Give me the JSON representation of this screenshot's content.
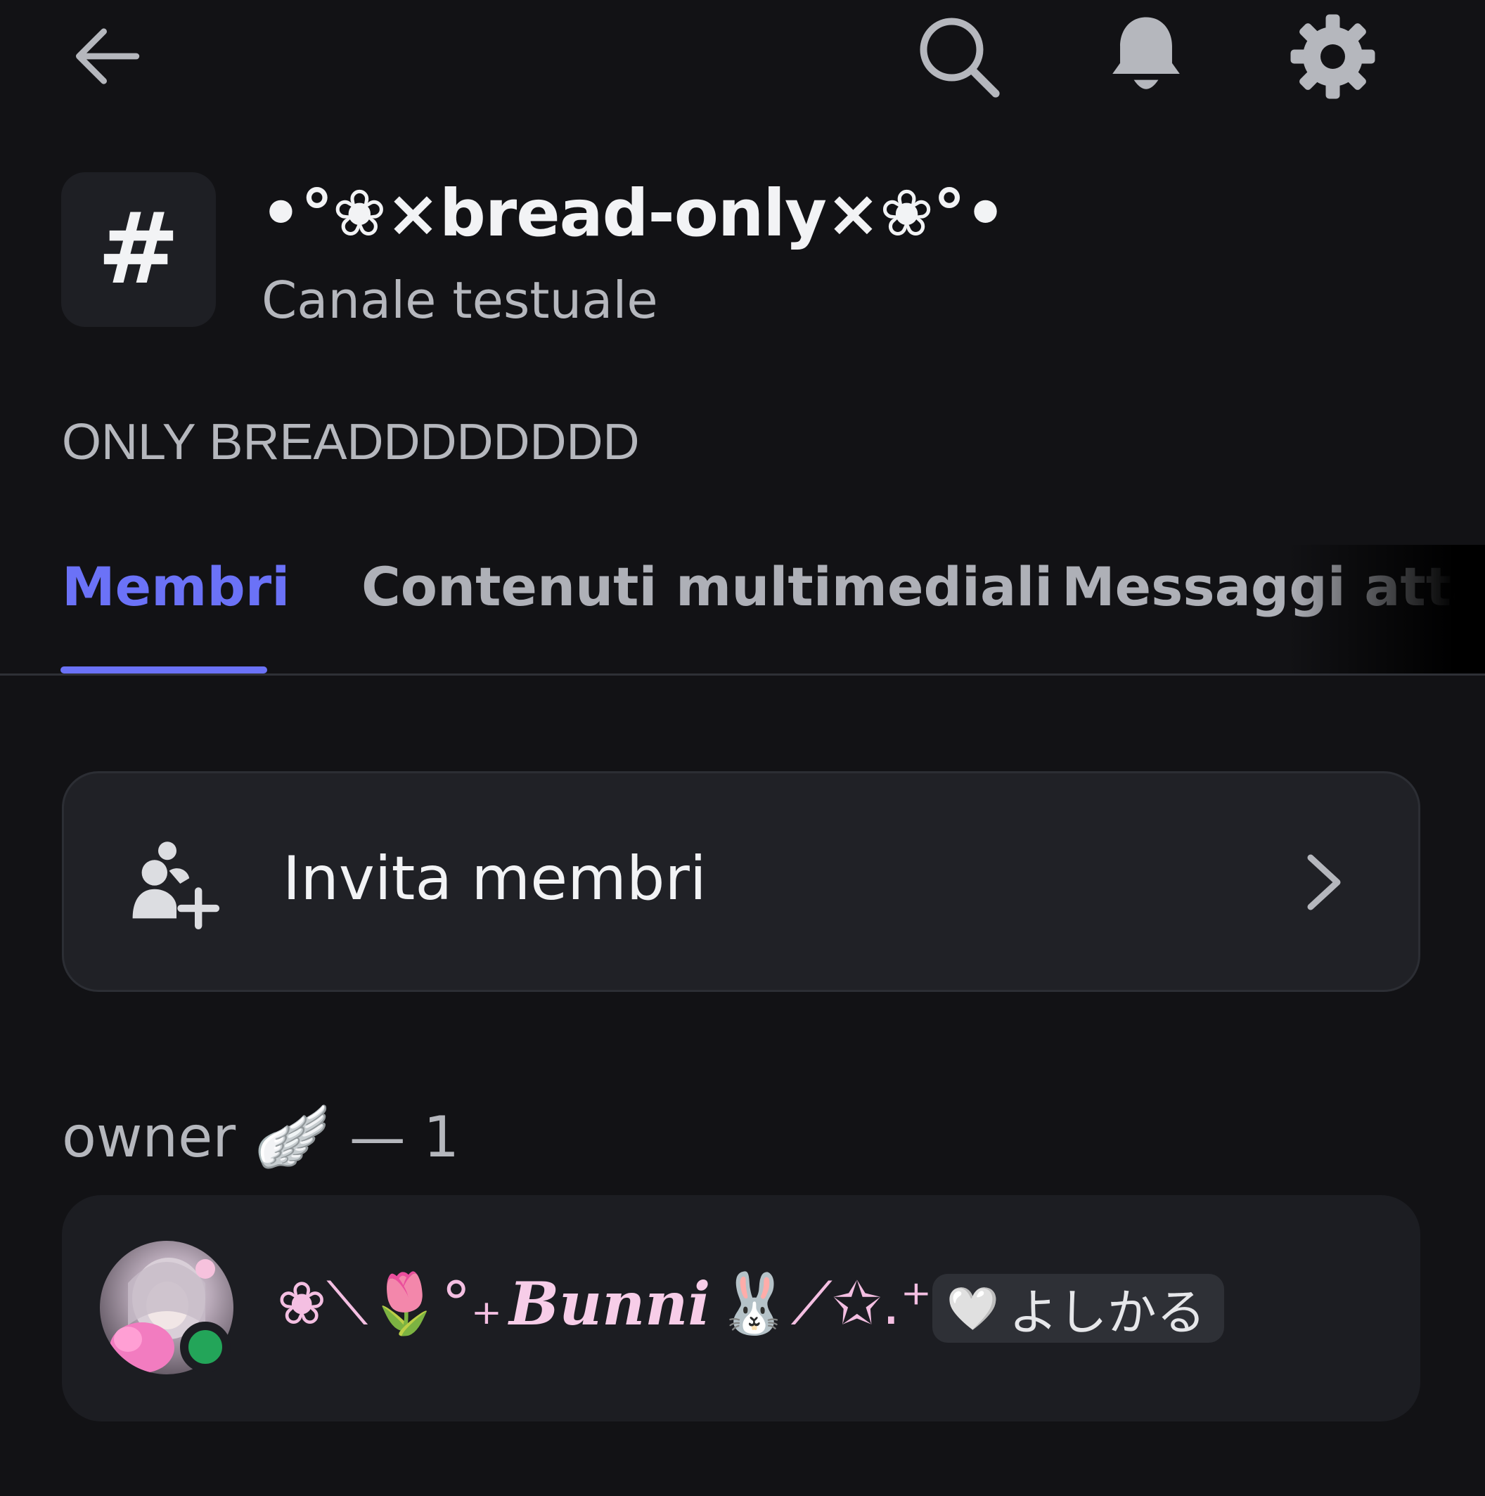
{
  "topbar": {
    "back_icon": "arrow-left-icon",
    "search_icon": "search-icon",
    "notifications_icon": "bell-icon",
    "settings_icon": "gear-icon"
  },
  "channel": {
    "hash_icon": "#",
    "name": "•°❀×bread-only×❀°•",
    "type": "Canale testuale",
    "topic": "ONLY BREADDDDDDDD"
  },
  "tabs": [
    {
      "label": "Membri",
      "active": true
    },
    {
      "label": "Contenuti multimediali",
      "active": false
    },
    {
      "label": "Messaggi attacc",
      "active": false
    }
  ],
  "invite": {
    "label": "Invita membri",
    "icon": "add-user-icon",
    "chevron": "chevron-right-icon"
  },
  "role": {
    "name": "owner",
    "emoji": "🪽",
    "count_text": "— 1"
  },
  "member": {
    "name_prefix": "❀⟍🌷°₊",
    "name_script": "Bunni",
    "name_suffix": "🐰⟋✩.⁺",
    "status": "online",
    "tag_icon": "🤍",
    "tag_text": "よしかる"
  },
  "colors": {
    "background": "#121215",
    "accent": "#6b72f7",
    "online": "#23a559"
  }
}
